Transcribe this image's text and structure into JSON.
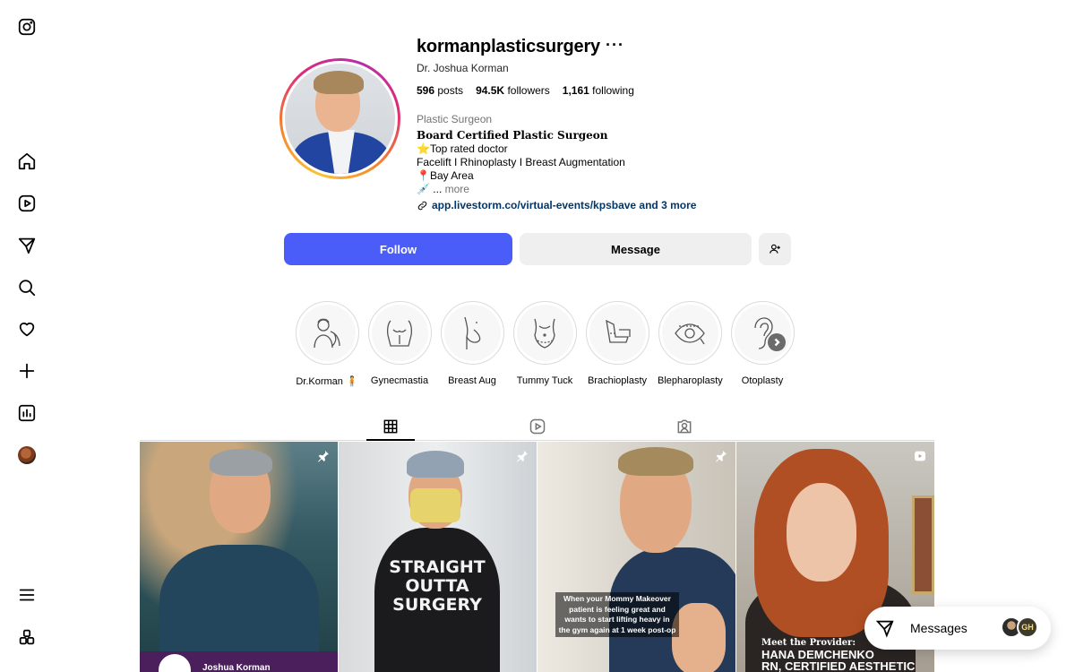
{
  "sidebar": {
    "items": [
      {
        "name": "instagram-logo-icon"
      },
      {
        "name": "home-icon"
      },
      {
        "name": "reels-icon"
      },
      {
        "name": "explore-icon"
      },
      {
        "name": "search-icon"
      },
      {
        "name": "notifications-icon"
      },
      {
        "name": "create-icon"
      },
      {
        "name": "dashboard-icon"
      },
      {
        "name": "profile-avatar-icon"
      },
      {
        "name": "menu-icon"
      },
      {
        "name": "more-apps-icon"
      }
    ]
  },
  "profile": {
    "username": "kormanplasticsurgery",
    "more": "···",
    "full_name": "Dr. Joshua Korman",
    "stats": {
      "posts_count": "596",
      "posts_label": "posts",
      "followers_count": "94.5K",
      "followers_label": "followers",
      "following_count": "1,161",
      "following_label": "following"
    },
    "category": "Plastic Surgeon",
    "bio": {
      "line1": "Board Certified Plastic Surgeon",
      "line2": "⭐Top rated doctor",
      "line3": "Facelift I Rhinoplasty I Breast Augmentation",
      "line4": "📍Bay Area",
      "line5_prefix": "💉 ...",
      "line5_more": "more"
    },
    "link": "app.livestorm.co/virtual-events/kpsbave and 3 more"
  },
  "actions": {
    "follow_label": "Follow",
    "message_label": "Message"
  },
  "highlights": [
    {
      "label": "Dr.Korman 🧍"
    },
    {
      "label": "Gynecmastia"
    },
    {
      "label": "Breast Aug"
    },
    {
      "label": "Tummy Tuck"
    },
    {
      "label": "Brachioplasty"
    },
    {
      "label": "Blepharoplasty"
    },
    {
      "label": "Otoplasty"
    }
  ],
  "tabs": [
    {
      "name": "posts-grid-icon",
      "active": true
    },
    {
      "name": "reels-tab-icon",
      "active": false
    },
    {
      "name": "tagged-icon",
      "active": false
    }
  ],
  "posts": [
    {
      "caption": "Joshua Korman",
      "pinned": true
    },
    {
      "caption": "STRAIGHT OUTTA SURGERY",
      "pinned": true
    },
    {
      "caption": "When your Mommy Makeover patient is feeling great and wants to start lifting heavy in the gym again at 1 week post-op",
      "pinned": true
    },
    {
      "caption_small": "Meet the Provider:",
      "caption_big1": "HANA DEMCHENKO",
      "caption_big2": "RN, CERTIFIED AESTHETIC",
      "reel": true
    }
  ],
  "messages": {
    "label": "Messages",
    "avatar_initials": "GH"
  },
  "colors": {
    "follow_button": "#4a5df9",
    "secondary_button": "#efefef",
    "story_ring_gradient": [
      "#f9c33a",
      "#f58529",
      "#dd2a7b",
      "#b62fa9"
    ]
  }
}
